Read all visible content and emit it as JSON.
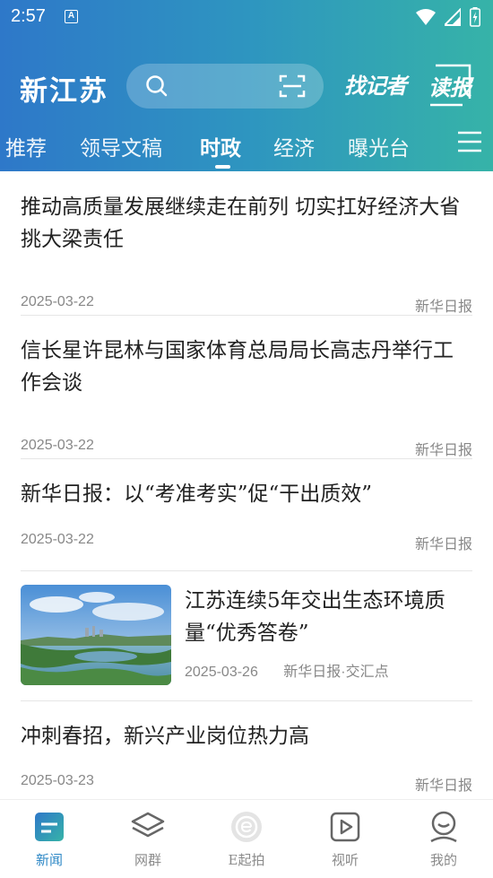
{
  "status": {
    "time": "2:57",
    "notification_glyph": "A"
  },
  "header": {
    "logo": "新江苏",
    "search": {
      "placeholder": ""
    },
    "zhaojizhe_label": "找记者",
    "dubao_label": "读报"
  },
  "tabs": [
    {
      "label": "推荐",
      "active": false
    },
    {
      "label": "领导文稿",
      "active": false
    },
    {
      "label": "时政",
      "active": true
    },
    {
      "label": "经济",
      "active": false
    },
    {
      "label": "曝光台",
      "active": false
    }
  ],
  "feed": [
    {
      "title": "推动高质量发展继续走在前列  切实扛好经济大省挑大梁责任",
      "date": "2025-03-22",
      "source": "新华日报"
    },
    {
      "title": "信长星许昆林与国家体育总局局长高志丹举行工作会谈",
      "date": "2025-03-22",
      "source": "新华日报"
    },
    {
      "title": "新华日报：以“考准考实”促“干出质效”",
      "date": "2025-03-22",
      "source": "新华日报"
    },
    {
      "title": "  江苏连续5年交出生态环境质量“优秀答卷”",
      "date": "2025-03-26",
      "source": "新华日报·交汇点",
      "thumbnail": "lake-landscape"
    },
    {
      "title": "冲刺春招，新兴产业岗位热力高",
      "date": "2025-03-23",
      "source": "新华日报"
    }
  ],
  "bottom_nav": [
    {
      "label": "新闻",
      "icon": "news-icon",
      "active": true
    },
    {
      "label": "网群",
      "icon": "layers-icon",
      "active": false
    },
    {
      "label": "E起拍",
      "icon": "e-camera-icon",
      "active": false
    },
    {
      "label": "视听",
      "icon": "play-icon",
      "active": false
    },
    {
      "label": "我的",
      "icon": "profile-icon",
      "active": false
    }
  ],
  "colors": {
    "header_start": "#2e78c9",
    "header_end": "#36b3a8",
    "nav_active": "#2e88c6",
    "meta_text": "#888888"
  }
}
